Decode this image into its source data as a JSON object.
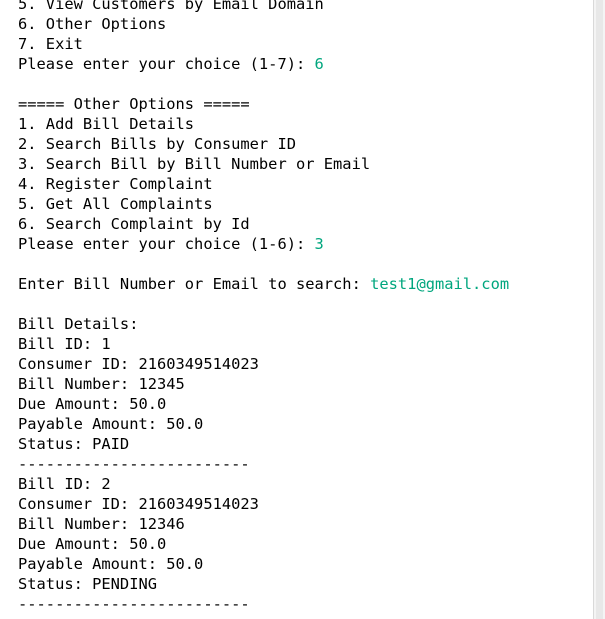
{
  "colors": {
    "text": "#000000",
    "user_input": "#00a67e",
    "background": "#ffffff"
  },
  "console": {
    "lines": [
      {
        "text": "5. View Customers by Email Domain"
      },
      {
        "text": "6. Other Options"
      },
      {
        "text": "7. Exit"
      },
      {
        "text": "Please enter your choice (1-7): ",
        "input": "6"
      },
      {
        "text": ""
      },
      {
        "text": "===== Other Options ====="
      },
      {
        "text": "1. Add Bill Details"
      },
      {
        "text": "2. Search Bills by Consumer ID"
      },
      {
        "text": "3. Search Bill by Bill Number or Email"
      },
      {
        "text": "4. Register Complaint"
      },
      {
        "text": "5. Get All Complaints"
      },
      {
        "text": "6. Search Complaint by Id"
      },
      {
        "text": "Please enter your choice (1-6): ",
        "input": "3"
      },
      {
        "text": ""
      },
      {
        "text": "Enter Bill Number or Email to search: ",
        "input": "test1@gmail.com"
      },
      {
        "text": ""
      },
      {
        "text": "Bill Details:"
      },
      {
        "text": "Bill ID: 1"
      },
      {
        "text": "Consumer ID: 2160349514023"
      },
      {
        "text": "Bill Number: 12345"
      },
      {
        "text": "Due Amount: 50.0"
      },
      {
        "text": "Payable Amount: 50.0"
      },
      {
        "text": "Status: PAID"
      },
      {
        "text": "-------------------------"
      },
      {
        "text": "Bill ID: 2"
      },
      {
        "text": "Consumer ID: 2160349514023"
      },
      {
        "text": "Bill Number: 12346"
      },
      {
        "text": "Due Amount: 50.0"
      },
      {
        "text": "Payable Amount: 50.0"
      },
      {
        "text": "Status: PENDING"
      },
      {
        "text": "-------------------------"
      }
    ]
  }
}
